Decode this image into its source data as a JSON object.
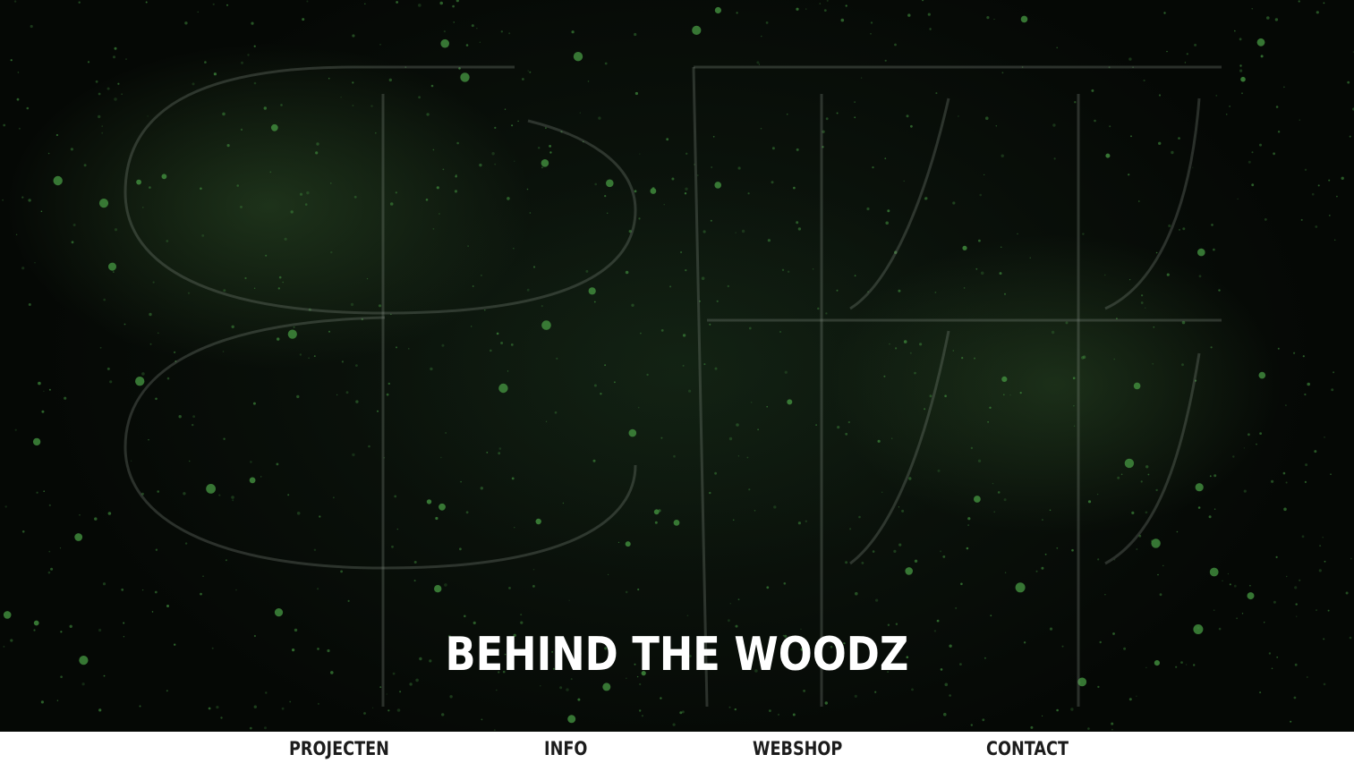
{
  "hero": {
    "title": "BEHIND THE WOODZ",
    "background_color": "#0a120b",
    "speckle_color": "#3f8a3c"
  },
  "nav": {
    "items": [
      {
        "label": "PROJECTEN"
      },
      {
        "label": "INFO"
      },
      {
        "label": "WEBSHOP"
      },
      {
        "label": "CONTACT"
      }
    ]
  }
}
